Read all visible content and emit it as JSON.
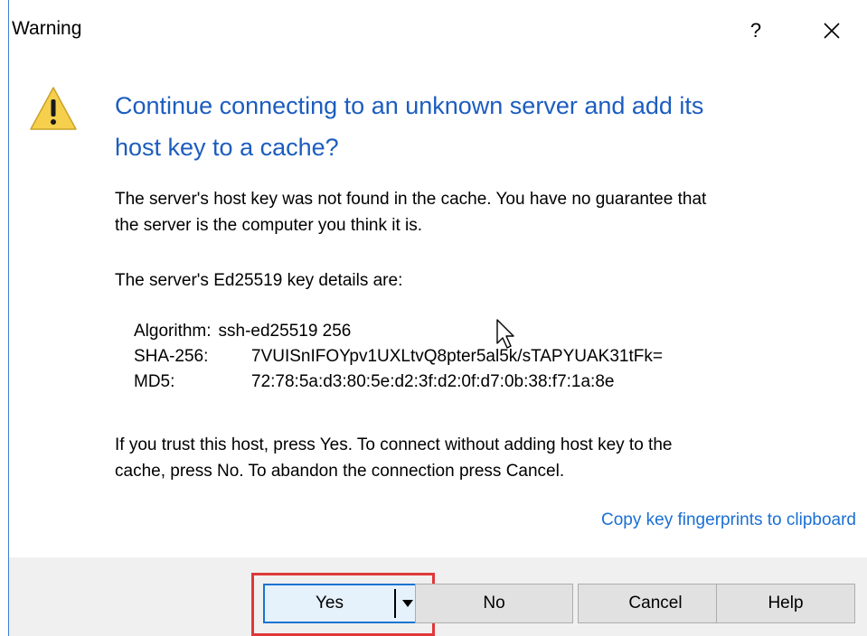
{
  "window": {
    "title": "Warning",
    "help_glyph": "?",
    "close_icon": "close-icon"
  },
  "message": {
    "icon": "warning-icon",
    "headline_line1": "Continue connecting to an unknown server and add its",
    "headline_line2": "host key to a cache?",
    "para1_line1": "The server's host key was not found in the cache. You have no guarantee that",
    "para1_line2": "the server is the computer you think it is.",
    "para2": "The server's Ed25519 key details are:",
    "details": [
      {
        "label": "Algorithm:",
        "value": "ssh-ed25519 256"
      },
      {
        "label": "SHA-256:",
        "value": "7VUISnIFOYpv1UXLtvQ8pter5al5k/sTAPYUAK31tFk="
      },
      {
        "label": "MD5:",
        "value": "72:78:5a:d3:80:5e:d2:3f:d2:0f:d7:0b:38:f7:1a:8e"
      }
    ],
    "para3_line1": "If you trust this host, press Yes. To connect without adding host key to the",
    "para3_line2": "cache, press No. To abandon the connection press Cancel.",
    "copy_link": "Copy key fingerprints to clipboard"
  },
  "buttons": {
    "yes": "Yes",
    "no": "No",
    "cancel": "Cancel",
    "help": "Help"
  },
  "colors": {
    "headline": "#1c5dbf",
    "link": "#1a6fd3",
    "highlight": "#e0383a",
    "default_button_border": "#1a74d1"
  }
}
